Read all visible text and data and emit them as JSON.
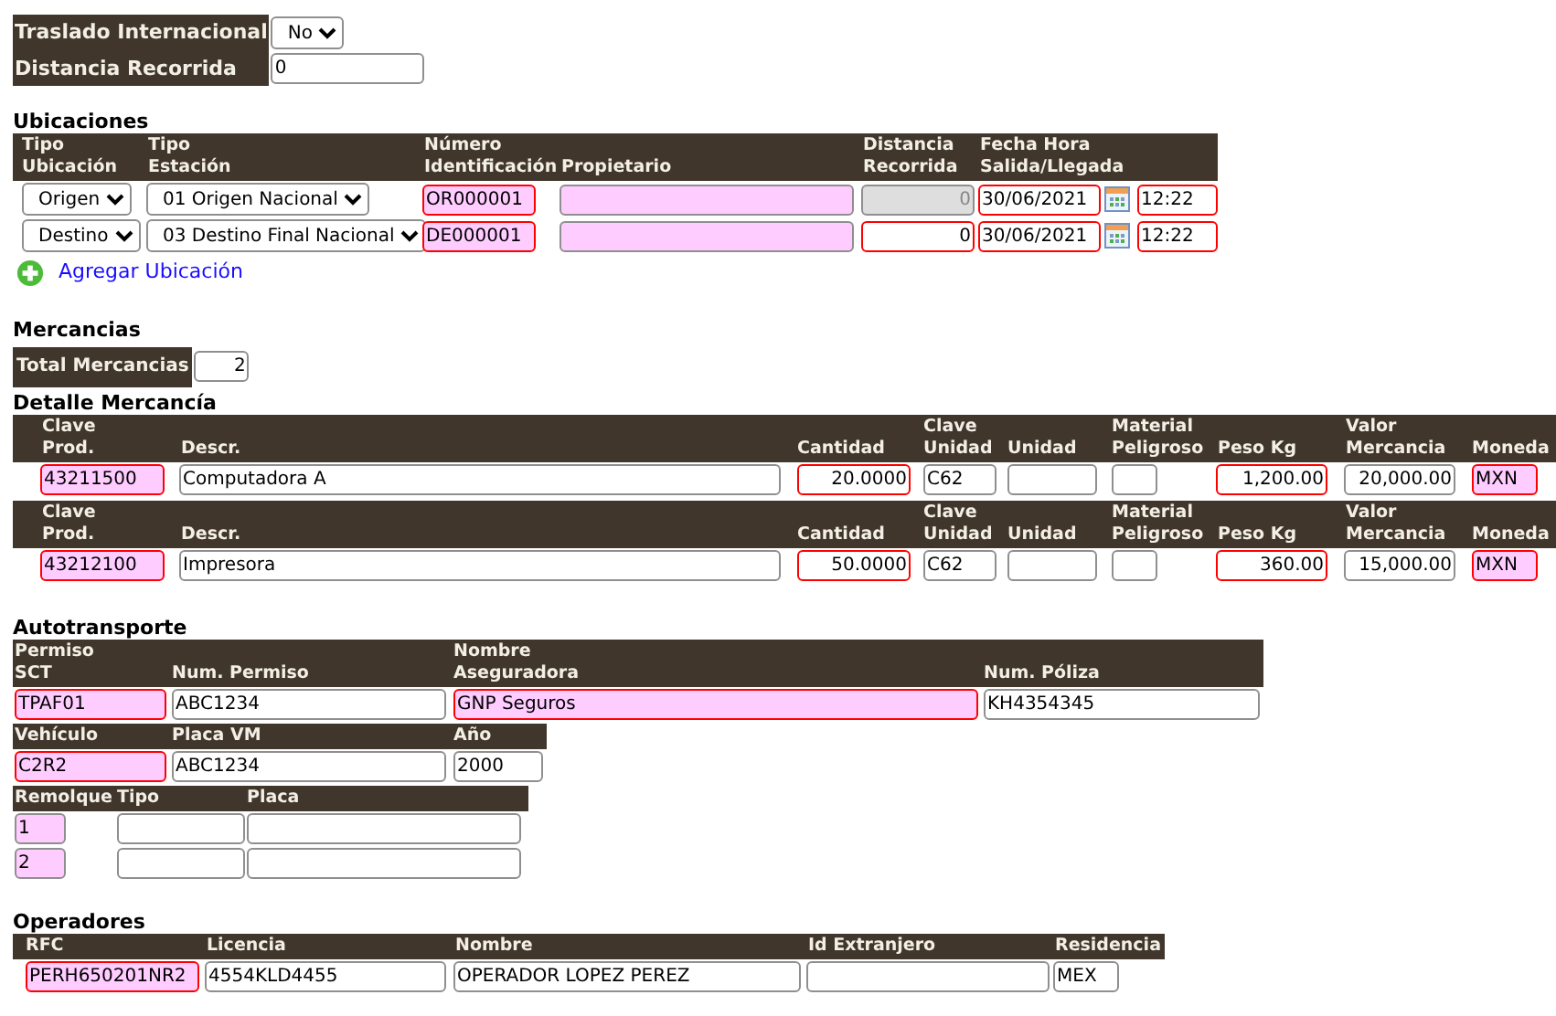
{
  "general": {
    "fields": [
      {
        "label": "Traslado Internacional",
        "kind": "select",
        "value": "No",
        "required": false,
        "highlight": false
      },
      {
        "label": "Distancia Recorrida",
        "kind": "input",
        "value": "0",
        "required": false,
        "highlight": false
      }
    ]
  },
  "ubicaciones": {
    "title": "Ubicaciones",
    "columns": [
      "Tipo\nUbicación",
      "Tipo\nEstación",
      "Número\nIdentificación",
      "Propietario",
      "Distancia\nRecorrida",
      "Fecha Hora\nSalida/Llegada"
    ],
    "rows": [
      {
        "fields": [
          {
            "kind": "select",
            "value": "Origen",
            "required": false,
            "highlight": false,
            "disabled": false
          },
          {
            "kind": "select",
            "value": "01 Origen Nacional",
            "required": false,
            "highlight": false,
            "disabled": false
          },
          {
            "kind": "input",
            "value": "OR000001",
            "required": true,
            "highlight": true,
            "disabled": false
          },
          {
            "kind": "input",
            "required": false,
            "highlight": true,
            "disabled": false
          },
          {
            "kind": "input",
            "value": "0",
            "required": false,
            "highlight": false,
            "disabled": true
          },
          {
            "kind": "date",
            "value": "30/06/2021",
            "required": true,
            "highlight": false,
            "disabled": false
          },
          {
            "kind": "input",
            "value": "12:22",
            "required": true,
            "highlight": false,
            "disabled": false
          }
        ]
      },
      {
        "fields": [
          {
            "kind": "select",
            "value": "Destino",
            "required": false,
            "highlight": false,
            "disabled": false
          },
          {
            "kind": "select",
            "value": "03 Destino Final Nacional",
            "required": false,
            "highlight": false,
            "disabled": false
          },
          {
            "kind": "input",
            "value": "DE000001",
            "required": true,
            "highlight": true,
            "disabled": false
          },
          {
            "kind": "input",
            "required": false,
            "highlight": true,
            "disabled": false
          },
          {
            "kind": "input",
            "value": "0",
            "required": true,
            "highlight": false,
            "disabled": false
          },
          {
            "kind": "date",
            "value": "30/06/2021",
            "required": true,
            "highlight": false,
            "disabled": false
          },
          {
            "kind": "input",
            "value": "12:22",
            "required": true,
            "highlight": false,
            "disabled": false
          }
        ]
      }
    ],
    "add_link": "Agregar Ubicación"
  },
  "mercancias": {
    "title": "Mercancias",
    "total_label": "Total Mercancias",
    "total": {
      "value": "2",
      "required": false,
      "highlight": false
    }
  },
  "detalle": {
    "title": "Detalle Mercancía",
    "items": [
      {
        "columns": [
          "Clave\nProd.",
          "Descr.",
          "Cantidad",
          "Clave\nUnidad",
          "Unidad",
          "Material\nPeligroso",
          "Peso Kg",
          "Valor\nMercancia",
          "Moneda"
        ],
        "fields": [
          {
            "value": "43211500",
            "required": true,
            "highlight": true
          },
          {
            "value": "Computadora A",
            "required": false,
            "highlight": false
          },
          {
            "value": "20.0000",
            "required": true,
            "highlight": false
          },
          {
            "value": "C62",
            "required": false,
            "highlight": false
          },
          {
            "required": false,
            "highlight": false
          },
          {
            "required": false,
            "highlight": false
          },
          {
            "value": "1,200.00",
            "required": true,
            "highlight": false
          },
          {
            "value": "20,000.00",
            "required": false,
            "highlight": false
          },
          {
            "value": "MXN",
            "required": true,
            "highlight": true
          }
        ]
      },
      {
        "columns": [
          "Clave\nProd.",
          "Descr.",
          "Cantidad",
          "Clave\nUnidad",
          "Unidad",
          "Material\nPeligroso",
          "Peso Kg",
          "Valor\nMercancia",
          "Moneda"
        ],
        "fields": [
          {
            "value": "43212100",
            "required": true,
            "highlight": true
          },
          {
            "value": "Impresora",
            "required": false,
            "highlight": false
          },
          {
            "value": "50.0000",
            "required": true,
            "highlight": false
          },
          {
            "value": "C62",
            "required": false,
            "highlight": false
          },
          {
            "required": false,
            "highlight": false
          },
          {
            "required": false,
            "highlight": false
          },
          {
            "value": "360.00",
            "required": true,
            "highlight": false
          },
          {
            "value": "15,000.00",
            "required": false,
            "highlight": false
          },
          {
            "value": "MXN",
            "required": true,
            "highlight": true
          }
        ]
      }
    ]
  },
  "autotransporte": {
    "title": "Autotransporte",
    "permiso": {
      "columns": [
        "Permiso\nSCT",
        "Num. Permiso",
        "Nombre\nAseguradora",
        "Num. Póliza"
      ],
      "rows": [
        {
          "fields": [
            {
              "value": "TPAF01",
              "required": true,
              "highlight": true
            },
            {
              "value": "ABC1234",
              "required": false,
              "highlight": false
            },
            {
              "value": "GNP Seguros",
              "required": true,
              "highlight": true
            },
            {
              "value": "KH4354345",
              "required": false,
              "highlight": false
            }
          ]
        }
      ]
    },
    "vehiculo": {
      "columns": [
        "Vehículo",
        "Placa VM",
        "Año"
      ],
      "rows": [
        {
          "fields": [
            {
              "value": "C2R2",
              "required": true,
              "highlight": true
            },
            {
              "value": "ABC1234",
              "required": false,
              "highlight": false
            },
            {
              "value": "2000",
              "required": false,
              "highlight": false
            }
          ]
        }
      ]
    },
    "remolques": {
      "columns": [
        "Remolque",
        "Tipo",
        "Placa"
      ],
      "rows": [
        {
          "fields": [
            {
              "value": "1",
              "required": false,
              "highlight": true
            },
            {
              "required": false,
              "highlight": false
            },
            {
              "required": false,
              "highlight": false
            }
          ]
        },
        {
          "fields": [
            {
              "value": "2",
              "required": false,
              "highlight": true
            },
            {
              "required": false,
              "highlight": false
            },
            {
              "required": false,
              "highlight": false
            }
          ]
        }
      ]
    }
  },
  "operadores": {
    "title": "Operadores",
    "columns": [
      "RFC",
      "Licencia",
      "Nombre",
      "Id Extranjero",
      "Residencia"
    ],
    "rows": [
      {
        "fields": [
          {
            "value": "PERH650201NR2",
            "required": true,
            "highlight": true
          },
          {
            "value": "4554KLD4455",
            "required": false,
            "highlight": false
          },
          {
            "value": "OPERADOR LOPEZ PEREZ",
            "required": false,
            "highlight": false
          },
          {
            "required": false,
            "highlight": false
          },
          {
            "value": "MEX",
            "required": false,
            "highlight": false
          }
        ]
      }
    ]
  }
}
